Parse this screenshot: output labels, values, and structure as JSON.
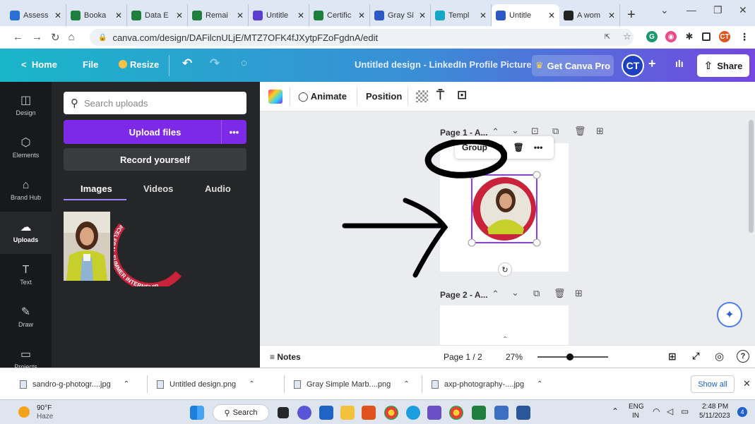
{
  "browser": {
    "tabs": [
      {
        "title": "Assess",
        "color": "#2a6fd6"
      },
      {
        "title": "Booka",
        "color": "#1e7f3e"
      },
      {
        "title": "Data E",
        "color": "#1e7f3e"
      },
      {
        "title": "Remai",
        "color": "#1e7f3e"
      },
      {
        "title": "Untitle",
        "color": "#5b3fd0"
      },
      {
        "title": "Certific",
        "color": "#1e7f3e"
      },
      {
        "title": "Gray Si",
        "color": "#2c59c6"
      },
      {
        "title": "Templ",
        "color": "#16a7c7"
      },
      {
        "title": "Untitle",
        "color": "#2c59c6",
        "active": true
      },
      {
        "title": "A wom",
        "color": "#222222"
      }
    ],
    "new_tab": "+",
    "url": "canva.com/design/DAFilcnULjE/MTZ7OFK4fJXytpFZoFgdnA/edit"
  },
  "header": {
    "home": "Home",
    "file": "File",
    "resize": "Resize",
    "doc_title": "Untitled design - LinkedIn Profile Picture",
    "pro": "Get Canva Pro",
    "avatar": "CT",
    "share": "Share"
  },
  "rail": [
    {
      "label": "Design",
      "icon": "layout-icon"
    },
    {
      "label": "Elements",
      "icon": "shapes-icon"
    },
    {
      "label": "Brand Hub",
      "icon": "brand-icon"
    },
    {
      "label": "Uploads",
      "icon": "cloud-upload-icon",
      "selected": true
    },
    {
      "label": "Text",
      "icon": "text-icon"
    },
    {
      "label": "Draw",
      "icon": "draw-icon"
    },
    {
      "label": "Projects",
      "icon": "folder-icon"
    }
  ],
  "panel": {
    "search_placeholder": "Search uploads",
    "upload": "Upload files",
    "more": "•••",
    "record": "Record yourself",
    "tabs": [
      "Images",
      "Videos",
      "Audio"
    ],
    "arc_text": "#CELEBAL SUMMER INTERNSHIP"
  },
  "toolbar": {
    "animate": "Animate",
    "position": "Position"
  },
  "canvas": {
    "page1_label": "Page 1 - A...",
    "page2_label": "Page 2 - A...",
    "group": "Group"
  },
  "status": {
    "notes": "Notes",
    "page": "Page 1 / 2",
    "zoom": "27%",
    "zoom_level": 0.27
  },
  "downloads": {
    "items": [
      "sandro-g-photogr....jpg",
      "Untitled design.png",
      "Gray Simple Marb....png",
      "axp-photography-....jpg"
    ],
    "show_all": "Show all"
  },
  "taskbar": {
    "temp": "90°F",
    "weather": "Haze",
    "search": "Search",
    "lang1": "ENG",
    "lang2": "IN",
    "time": "2:48 PM",
    "date": "5/11/2023",
    "badge": "4"
  },
  "colors": {
    "accent": "#7d2ae8",
    "panel": "#252627",
    "rail": "#18191b",
    "selection": "#8b3dff"
  }
}
